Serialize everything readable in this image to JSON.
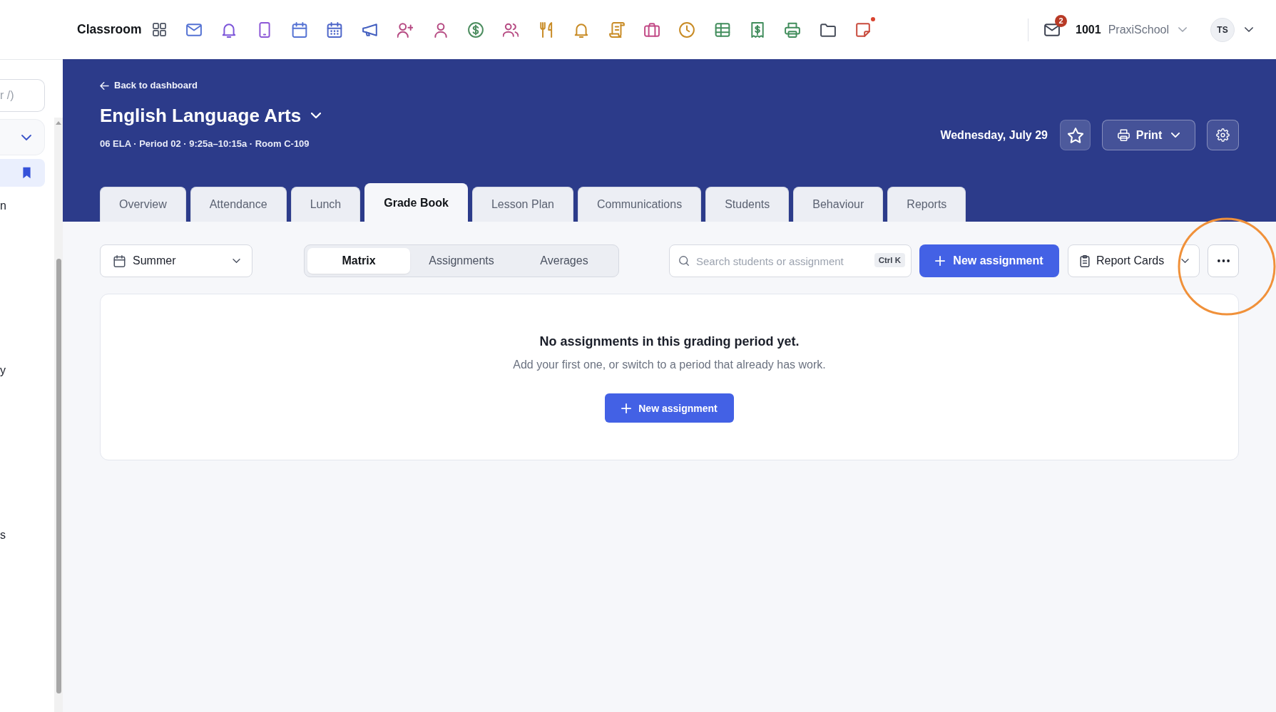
{
  "top_bar": {
    "app_name": "Classroom",
    "apps": [
      {
        "kind": "mail",
        "color": "#5472d3",
        "dot": false
      },
      {
        "kind": "bell",
        "color": "#7c55d9",
        "dot": false
      },
      {
        "kind": "tablet",
        "color": "#8c57d6",
        "dot": false
      },
      {
        "kind": "calendar",
        "color": "#5472d3",
        "dot": false
      },
      {
        "kind": "schedule",
        "color": "#4e66c9",
        "dot": false
      },
      {
        "kind": "megaphone",
        "color": "#4460c0",
        "dot": false
      },
      {
        "kind": "adduser",
        "color": "#b64a82",
        "dot": false
      },
      {
        "kind": "user",
        "color": "#b64a82",
        "dot": false
      },
      {
        "kind": "money",
        "color": "#4c8d5f",
        "dot": false
      },
      {
        "kind": "group",
        "color": "#b64a82",
        "dot": false
      },
      {
        "kind": "dining",
        "color": "#c88b25",
        "dot": false
      },
      {
        "kind": "bell",
        "color": "#c88b25",
        "dot": false
      },
      {
        "kind": "scroll",
        "color": "#c88b25",
        "dot": false
      },
      {
        "kind": "briefcase",
        "color": "#c24a86",
        "dot": false
      },
      {
        "kind": "clock",
        "color": "#c88b25",
        "dot": false
      },
      {
        "kind": "grid",
        "color": "#418d5c",
        "dot": false
      },
      {
        "kind": "receipt",
        "color": "#418d5c",
        "dot": false
      },
      {
        "kind": "printer",
        "color": "#418d5c",
        "dot": false
      },
      {
        "kind": "folder",
        "color": "#474d5a",
        "dot": false
      },
      {
        "kind": "note",
        "color": "#c8493b",
        "dot": true
      }
    ],
    "messages": {
      "count": "2"
    },
    "school": {
      "code": "1001",
      "name": "PraxiSchool"
    },
    "user": {
      "initials": "TS"
    }
  },
  "sidebar": {
    "search": {
      "placeholder": "r /)"
    },
    "items": [
      {
        "kind": "bookmark",
        "selected": true
      },
      {
        "kind": "link",
        "label": "n",
        "selected": false
      },
      {
        "kind": "link",
        "label": "y",
        "selected": false
      },
      {
        "kind": "link",
        "label": "s",
        "selected": false
      }
    ]
  },
  "header": {
    "back_link": "Back to dashboard",
    "title": "English Language Arts",
    "subtitle": "06 ELA · Period 02 · 9:25a–10:15a · Room C-109",
    "date": "Wednesday, July 29",
    "favorite": false,
    "print": "Print"
  },
  "tabs": [
    {
      "label": "Overview",
      "selected": false
    },
    {
      "label": "Attendance",
      "selected": false
    },
    {
      "label": "Lunch",
      "selected": false
    },
    {
      "label": "Grade Book",
      "selected": true
    },
    {
      "label": "Lesson Plan",
      "selected": false
    },
    {
      "label": "Communications",
      "selected": false
    },
    {
      "label": "Students",
      "selected": false
    },
    {
      "label": "Behaviour",
      "selected": false
    },
    {
      "label": "Reports",
      "selected": false
    }
  ],
  "toolbar": {
    "period": "Summer",
    "views": [
      {
        "label": "Matrix",
        "selected": true
      },
      {
        "label": "Assignments",
        "selected": false
      },
      {
        "label": "Averages",
        "selected": false
      }
    ],
    "search": {
      "placeholder": "Search students or assignment",
      "shortcut": "Ctrl K"
    },
    "new_button": "New assignment",
    "report_button": "Report Cards",
    "more_button": {
      "highlighted": true
    }
  },
  "empty_state": {
    "title": "No assignments in this grading period yet.",
    "message": "Add your first one, or switch to a period that already has work.",
    "button": "New assignment"
  }
}
